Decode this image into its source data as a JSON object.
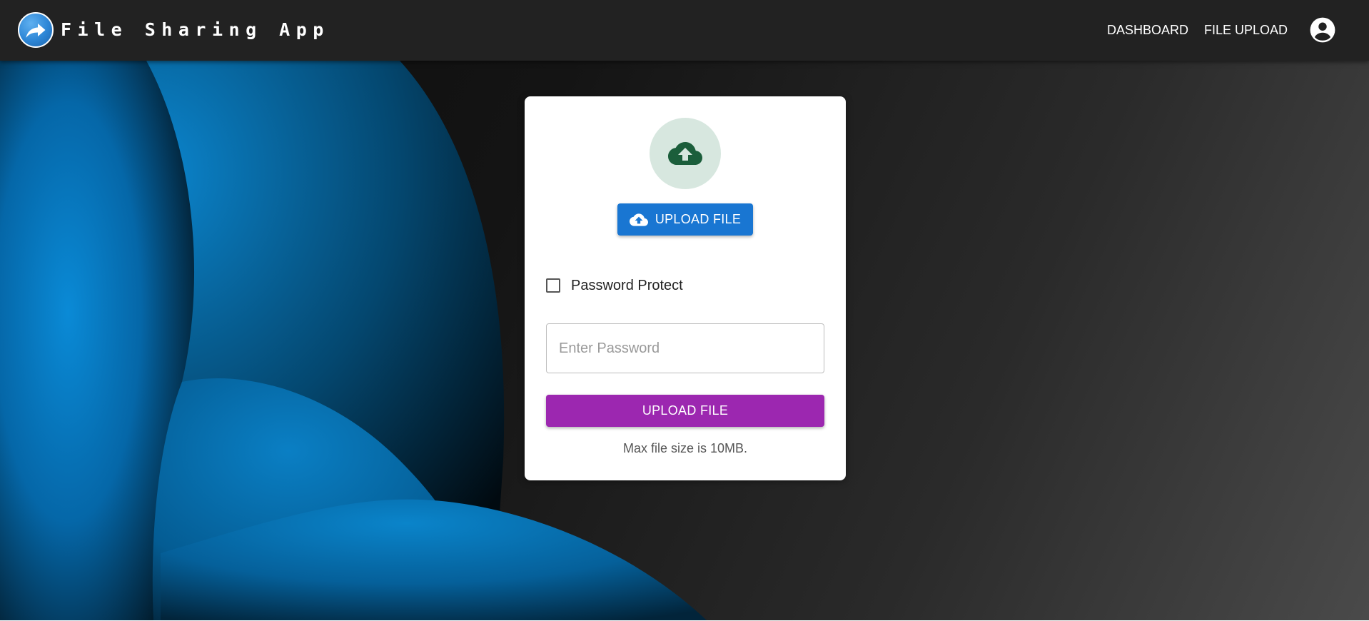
{
  "app": {
    "title": "File Sharing App",
    "accent": "#1976d2",
    "logo_icon": "forward-arrow-icon"
  },
  "nav": {
    "items": [
      {
        "label": "DASHBOARD"
      },
      {
        "label": "FILE UPLOAD"
      }
    ],
    "account_icon": "account-circle-icon"
  },
  "upload_card": {
    "header_icon": "cloud-upload-icon",
    "choose_button_label": "UPLOAD FILE",
    "choose_button_color": "#1976d2",
    "password_protect": {
      "label": "Password Protect",
      "checked": false
    },
    "password_input": {
      "placeholder": "Enter Password",
      "value": ""
    },
    "submit_button_label": "UPLOAD FILE",
    "submit_button_color": "#9c27b0",
    "note": "Max file size is 10MB."
  }
}
